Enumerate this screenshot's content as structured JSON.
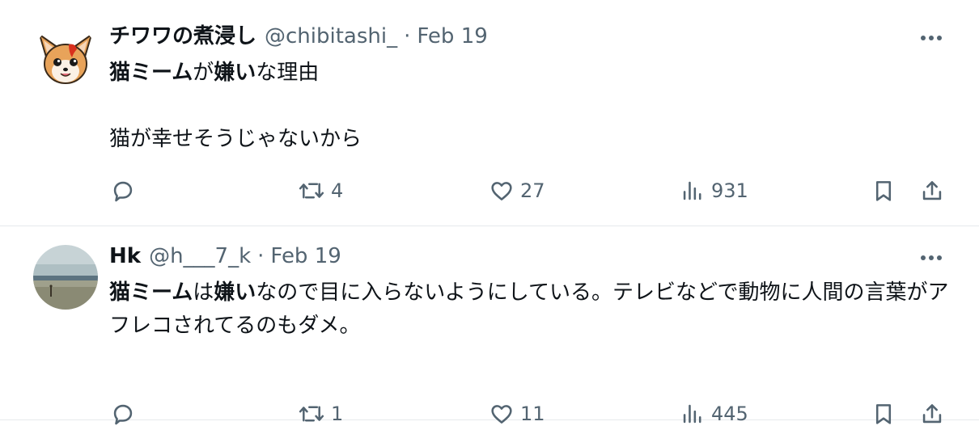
{
  "tweets": [
    {
      "name": "チワワの煮浸し",
      "handle": "@chibitashi_",
      "separator": "·",
      "date": "Feb 19",
      "avatar_icon": "chihuahua-cartoon-avatar",
      "text": {
        "line1_bold_a": "猫ミーム",
        "line1_plain_a": "が",
        "line1_bold_b": "嫌い",
        "line1_plain_b": "な理由",
        "line2": "猫が幸せそうじゃないから"
      },
      "stats": {
        "replies": "",
        "retweets": "4",
        "likes": "27",
        "views": "931"
      }
    },
    {
      "name": "Hk",
      "handle": "@h___7_k",
      "separator": "·",
      "date": "Feb 19",
      "avatar_icon": "beach-landscape-avatar",
      "text": {
        "bold_a": "猫ミーム",
        "plain_a": "は",
        "bold_b": "嫌い",
        "plain_b": "なので目に入らないようにしている。テレビなどで動物に人間の言葉がアフレコされてるのもダメ。"
      },
      "stats": {
        "replies": "",
        "retweets": "1",
        "likes": "11",
        "views": "445"
      }
    }
  ],
  "icons": {
    "more": "more-horizontal-icon",
    "reply": "reply-bubble-icon",
    "retweet": "retweet-icon",
    "like": "heart-icon",
    "views": "views-bar-chart-icon",
    "bookmark": "bookmark-icon",
    "share": "share-upload-icon"
  },
  "colors": {
    "text": "#0f1419",
    "secondary": "#536471",
    "divider": "#e6e9ec"
  }
}
